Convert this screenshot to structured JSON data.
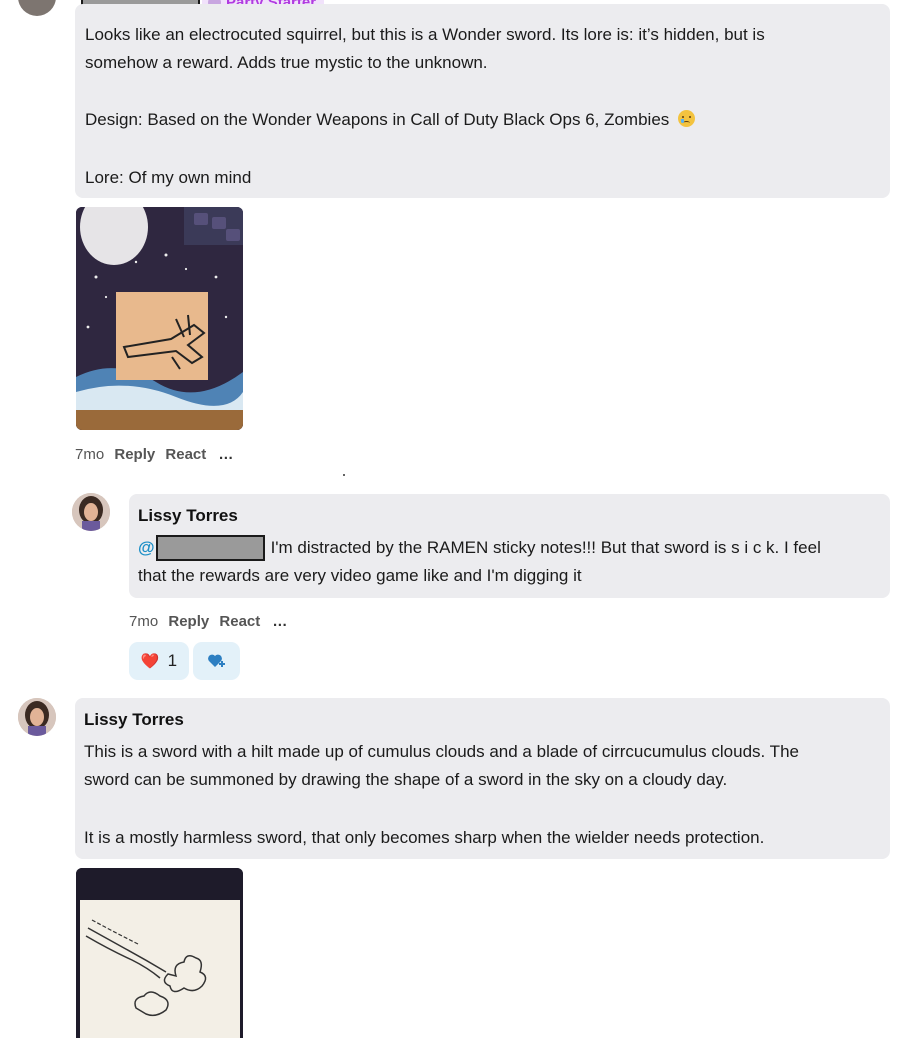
{
  "post1": {
    "badge": "Party Starter",
    "line1": "Looks like an electrocuted squirrel, but this is a Wonder sword. Its lore is: it’s hidden, but is",
    "line2": "somehow a reward. Adds true mystic to the unknown.",
    "design": "Design: Based on the Wonder Weapons in Call of Duty Black Ops 6, Zombies",
    "lore": "Lore: Of my own mind",
    "time": "7mo",
    "reply": "Reply",
    "react": "React",
    "more": "…"
  },
  "reply1": {
    "author": "Lissy Torres",
    "at": "@",
    "line1": "I'm distracted by the RAMEN sticky notes!!! But that sword is s i c k. I feel",
    "line2": "that the rewards are very video game like and I'm digging it",
    "time": "7mo",
    "reply": "Reply",
    "react": "React",
    "more": "…",
    "reaction_emoji": "❤️",
    "reaction_count": "1"
  },
  "post2": {
    "author": "Lissy Torres",
    "line1": "This is a sword with a hilt made up of cumulus clouds and a blade of cirrcucumulus clouds. The",
    "line2": "sword can be summoned by drawing the shape of a sword in the sky on a cloudy day.",
    "line3": "It is a mostly harmless sword, that only becomes sharp when the wielder needs protection."
  },
  "colors": {
    "bubble": "#ececef",
    "mention": "#1c8fc7",
    "badge_text": "#b13be0",
    "badge_bg": "#f1e2fb",
    "pill_bg": "#e3f1f9"
  }
}
